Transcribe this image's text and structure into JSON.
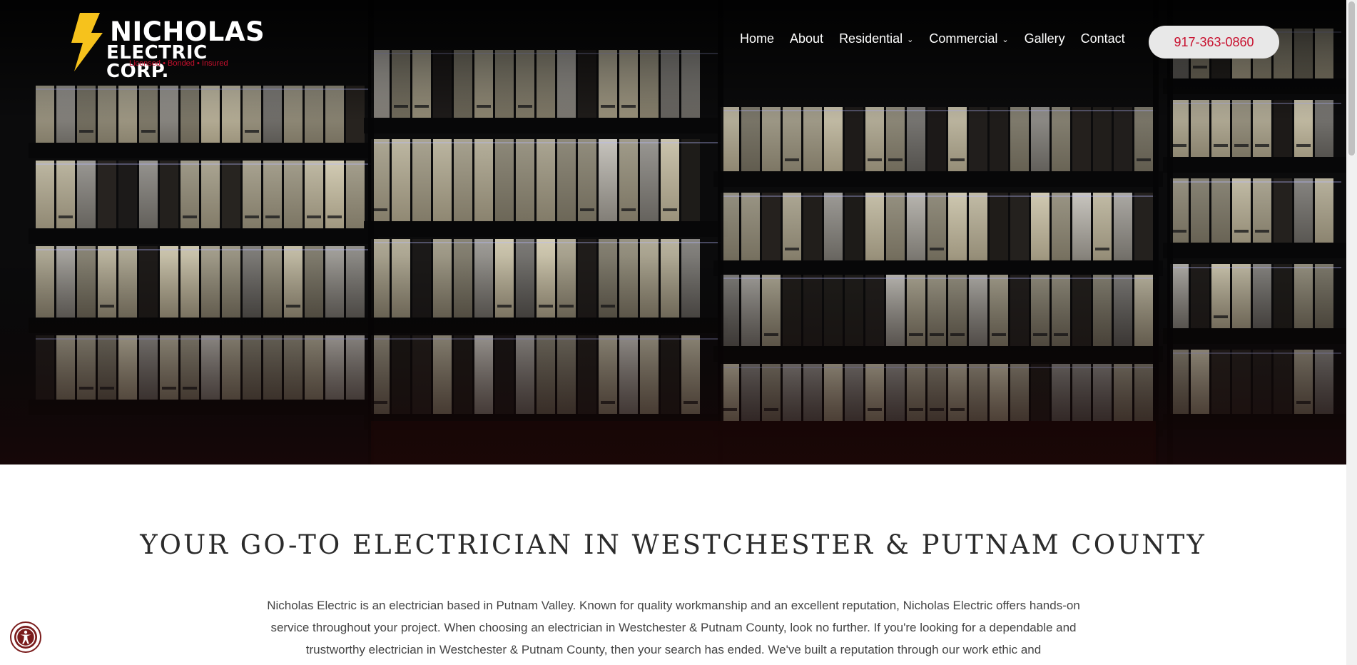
{
  "brand": {
    "name_line1": "NICHOLAS",
    "name_line2": "ELECTRIC CORP.",
    "tagline": "Licensed • Bonded • Insured",
    "bolt_color": "#f6c21c",
    "tagline_color": "#c8102e"
  },
  "nav": {
    "items": [
      {
        "label": "Home"
      },
      {
        "label": "About"
      },
      {
        "label": "Residential",
        "dropdown": true
      },
      {
        "label": "Commercial",
        "dropdown": true
      },
      {
        "label": "Gallery"
      },
      {
        "label": "Contact"
      }
    ],
    "phone": "917-363-0860"
  },
  "hero": {
    "image_icon": "office-building-night-photo"
  },
  "content": {
    "heading": "YOUR GO-TO ELECTRICIAN IN WESTCHESTER & PUTNAM COUNTY",
    "intro": "Nicholas Electric is an electrician based in Putnam Valley. Known for quality workmanship and an excellent reputation, Nicholas Electric offers hands-on service throughout your project. When choosing an electrician in Westchester & Putnam County, look no further. If you're looking for a dependable and trustworthy electrician in Westchester & Putnam County, then your search has ended. We've built a reputation through our work ethic and"
  },
  "accessibility": {
    "icon": "accessibility-person-icon"
  },
  "colors": {
    "accent": "#c8102e",
    "hero_bg": "#0b0b0c",
    "window_light": "#cfc6a6"
  }
}
